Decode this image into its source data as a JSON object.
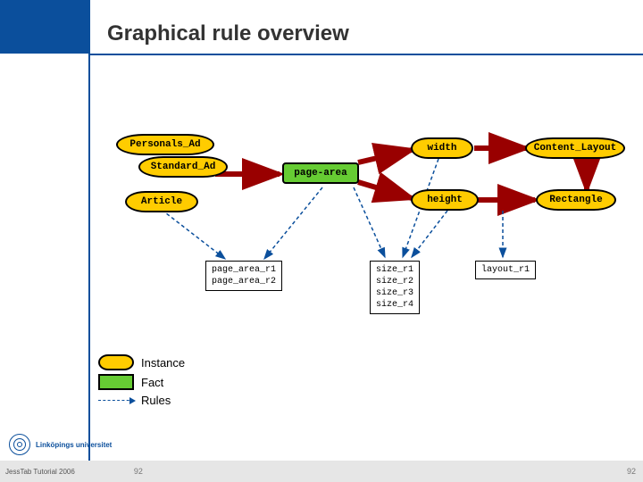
{
  "title": "Graphical rule overview",
  "nodes": {
    "personals_ad": "Personals_Ad",
    "standard_ad": "Standard_Ad",
    "article": "Article",
    "page_area": "page-area",
    "width": "width",
    "height": "height",
    "content_layout": "Content_Layout",
    "rectangle": "Rectangle"
  },
  "rule_boxes": {
    "page_area": [
      "page_area_r1",
      "page_area_r2"
    ],
    "size": [
      "size_r1",
      "size_r2",
      "size_r3",
      "size_r4"
    ],
    "layout": [
      "layout_r1"
    ]
  },
  "legend": {
    "instance": "Instance",
    "fact": "Fact",
    "rules": "Rules"
  },
  "footer": {
    "left": "JessTab Tutorial 2006",
    "page_left": "92",
    "page_right": "92"
  },
  "university": "Linköpings universitet"
}
